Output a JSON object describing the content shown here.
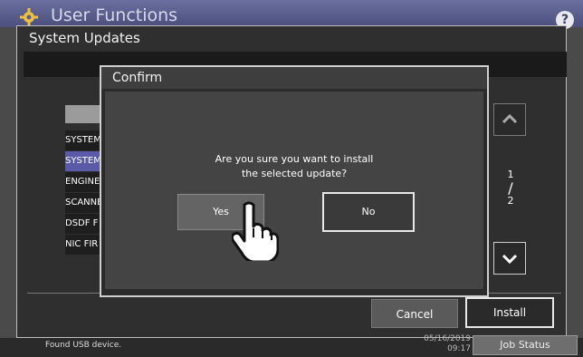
{
  "app": {
    "title": "User Functions",
    "help_label": "?"
  },
  "panel": {
    "title": "System Updates"
  },
  "update_list": {
    "items": [
      {
        "label": "SYSTEM",
        "selected": false
      },
      {
        "label": "SYSTEM",
        "selected": true
      },
      {
        "label": "ENGINE",
        "selected": false
      },
      {
        "label": "SCANNE",
        "selected": false
      },
      {
        "label": "DSDF F",
        "selected": false
      },
      {
        "label": "NIC FIR",
        "selected": false
      }
    ]
  },
  "pager": {
    "current": "1",
    "separator": "/",
    "total": "2"
  },
  "footer": {
    "cancel_label": "Cancel",
    "install_label": "Install"
  },
  "status": {
    "message": "Found USB device.",
    "date": "05/16/2019",
    "time": "09:17",
    "job_status_label": "Job Status"
  },
  "dialog": {
    "title": "Confirm",
    "message_line1": "Are you sure you want to install",
    "message_line2": "the selected update?",
    "yes_label": "Yes",
    "no_label": "No"
  },
  "colors": {
    "accent": "#5a5aa8",
    "topbar": "#5b5f8e"
  }
}
